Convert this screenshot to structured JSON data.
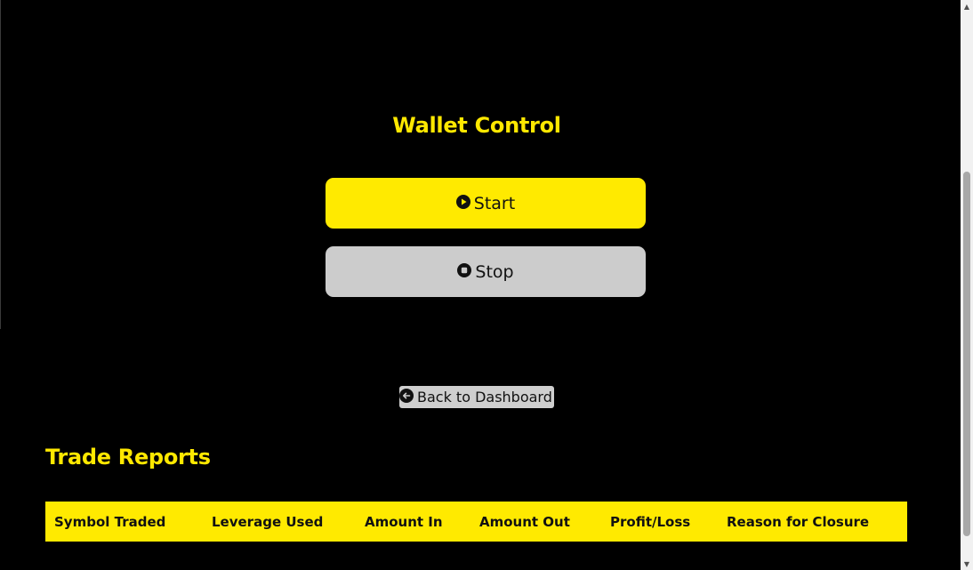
{
  "wallet_control": {
    "title": "Wallet Control",
    "start_label": "Start",
    "stop_label": "Stop",
    "start_icon": "play-circle-icon",
    "stop_icon": "stop-circle-icon"
  },
  "navigation": {
    "back_label": "Back to Dashboard",
    "back_icon": "arrow-left-circle-icon"
  },
  "trade_reports": {
    "title": "Trade Reports",
    "columns": [
      "Symbol Traded",
      "Leverage Used",
      "Amount In",
      "Amount Out",
      "Profit/Loss",
      "Reason for Closure"
    ]
  },
  "colors": {
    "accent": "#FFE800",
    "background": "#000000",
    "stop_button": "#CCCCCC"
  }
}
